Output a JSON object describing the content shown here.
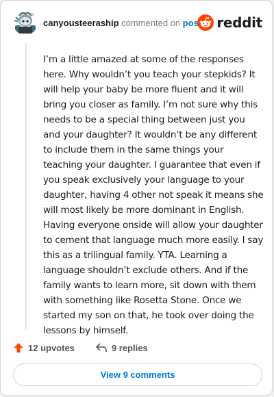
{
  "header": {
    "username": "canyousteeraship",
    "action_text": "commented on",
    "post_link": "post",
    "brand": "reddit",
    "brand_color": "#ff4500"
  },
  "comment": {
    "text": "I’m a little amazed at some of the responses here. Why wouldn’t you teach your stepkids? It will help your baby be more fluent and it will bring you closer as family. I’m not sure why this needs to be a special thing between just you and your daughter? It wouldn’t be any different to include them in the same things your teaching your daughter. I guarantee that even if you speak exclusively your language to your daughter, having 4 other not speak it means she will most likely be more dominant in English. Having everyone onside will allow your daughter to cement that language much more easily. I say this as a trilingual family. YTA. Learning a language shouldn’t exclude others. And if the family wants to learn more, sit down with them with something like Rosetta Stone. Once we started my son on that, he took over doing the lessons by himself."
  },
  "actions": {
    "upvotes": "12 upvotes",
    "replies": "9 replies",
    "upvote_icon": "arrow-up-icon",
    "reply_icon": "reply-arrow-icon"
  },
  "view_button": {
    "label": "View 9 comments"
  }
}
